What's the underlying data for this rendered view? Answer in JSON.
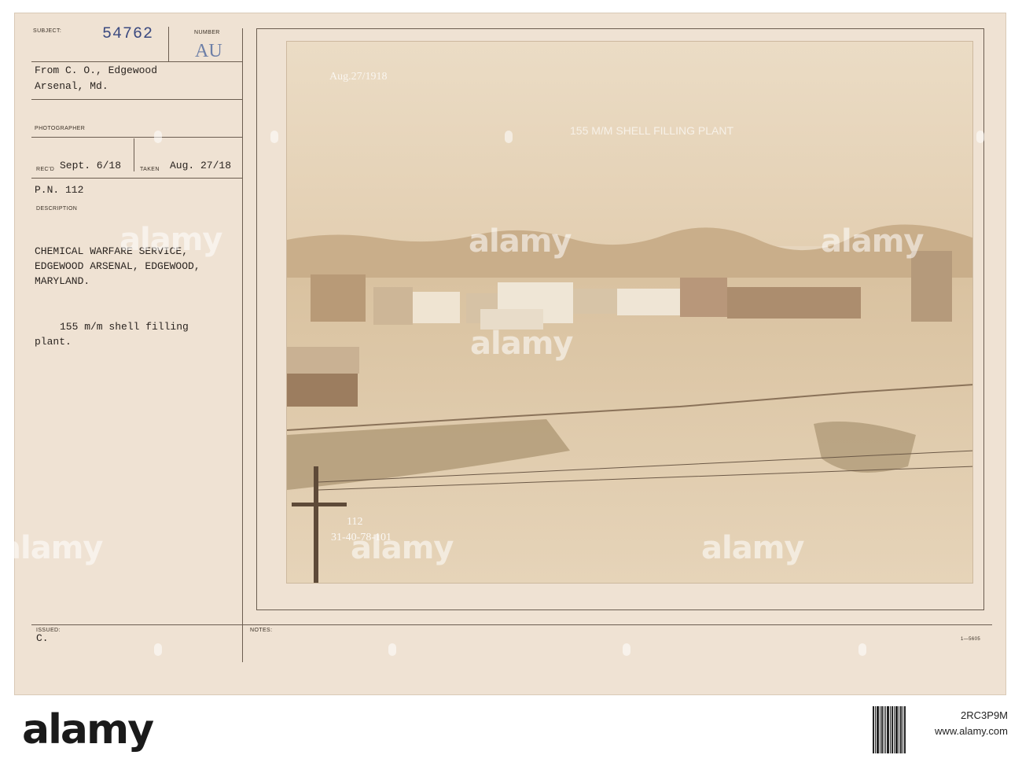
{
  "card": {
    "subject_label": "SUBJECT:",
    "subject_number": "54762",
    "number_label": "NUMBER",
    "number_stamp": "AU",
    "from_line1": "From C. O., Edgewood",
    "from_line2": "Arsenal, Md.",
    "photographer_label": "PHOTOGRAPHER",
    "recd_label": "REC'D",
    "recd_date": "Sept. 6/18",
    "taken_label": "TAKEN",
    "taken_date": "Aug. 27/18",
    "pn": "P.N. 112",
    "description_label": "DESCRIPTION",
    "desc_line1": "CHEMICAL WARFARE SERVICE,",
    "desc_line2": "EDGEWOOD ARSENAL, EDGEWOOD,",
    "desc_line3": "MARYLAND.",
    "caption_line1": "155 m/m shell filling",
    "caption_line2": "plant.",
    "issued_label": "ISSUED:",
    "issued_value": "C.",
    "notes_label": "NOTES:",
    "form_code": "1—5605"
  },
  "photo": {
    "date_inscription": "Aug.27/1918",
    "title_inscription": "155 M/M SHELL FILLING PLANT",
    "negative_line1": "112",
    "negative_line2": "31-40-78-101"
  },
  "watermark": {
    "text": "alamy"
  },
  "footer": {
    "logo": "alamy",
    "image_id": "2RC3P9M",
    "url": "www.alamy.com"
  }
}
